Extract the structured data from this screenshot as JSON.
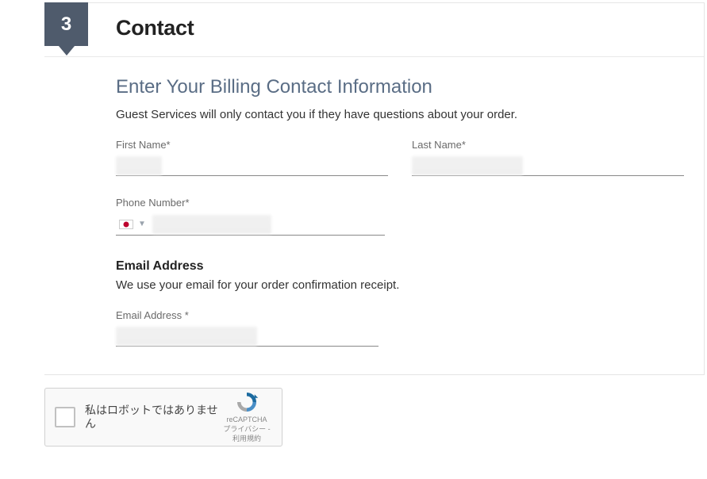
{
  "step": {
    "number": "3",
    "title": "Contact"
  },
  "billing": {
    "heading": "Enter Your Billing Contact Information",
    "description": "Guest Services will only contact you if they have questions about your order.",
    "firstNameLabel": "First Name*",
    "lastNameLabel": "Last Name*",
    "phoneLabel": "Phone Number*",
    "firstNameValue": "",
    "lastNameValue": "",
    "phoneValue": "",
    "countryFlag": "jp"
  },
  "email": {
    "heading": "Email Address",
    "description": "We use your email for your order confirmation receipt.",
    "label": "Email Address *",
    "value": ""
  },
  "recaptcha": {
    "label": "私はロボットではありません",
    "brand": "reCAPTCHA",
    "privacy": "プライバシー",
    "terms": "利用規約",
    "separator": " - "
  }
}
